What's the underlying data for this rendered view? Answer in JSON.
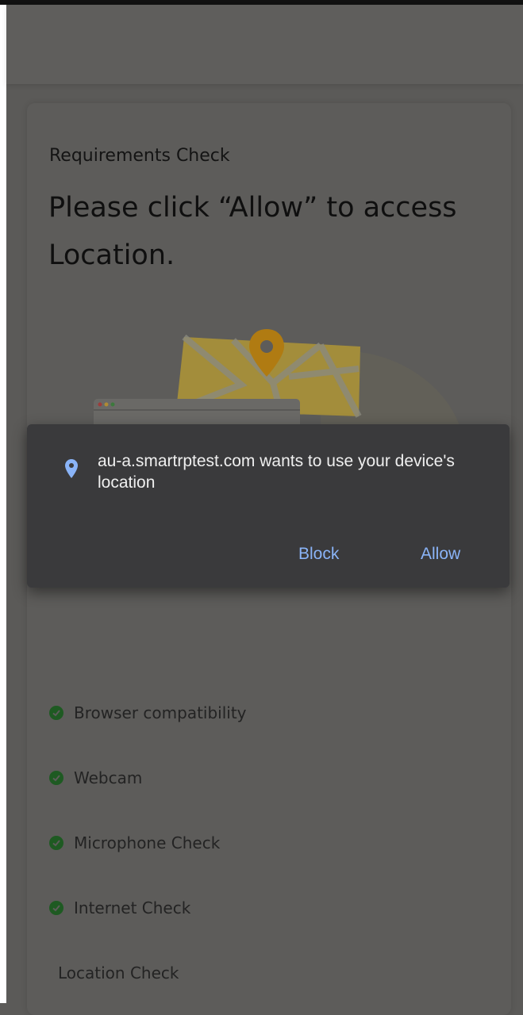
{
  "page": {
    "eyebrow": "Requirements Check",
    "headline": "Please click “Allow” to access Location."
  },
  "checks": [
    {
      "label": "Browser compatibility",
      "status": "done"
    },
    {
      "label": "Webcam",
      "status": "done"
    },
    {
      "label": "Microphone Check",
      "status": "done"
    },
    {
      "label": "Internet Check",
      "status": "done"
    },
    {
      "label": "Location Check",
      "status": "pending"
    }
  ],
  "permission_dialog": {
    "message": "au-a.smartrptest.com wants to use your device's location",
    "block_label": "Block",
    "allow_label": "Allow",
    "icon": "location-pin-icon"
  },
  "colors": {
    "dialog_bg": "#3a3a3c",
    "dialog_button": "#8ab4f8",
    "check_green": "#1e5a22",
    "map_yellow": "#a38d3b",
    "pin_orange": "#b07b12"
  }
}
